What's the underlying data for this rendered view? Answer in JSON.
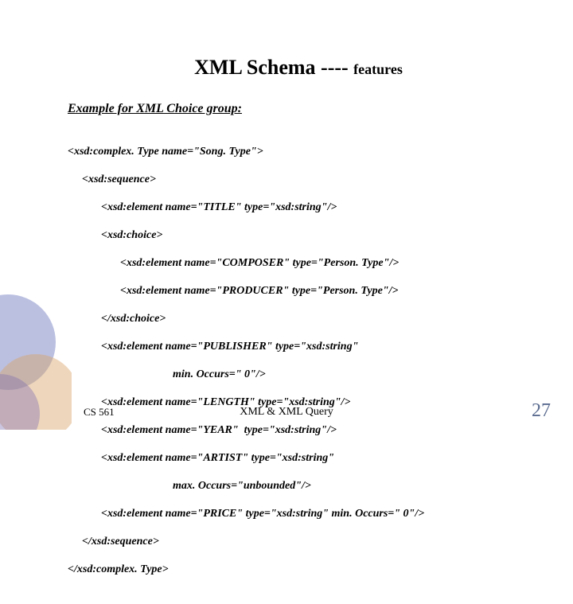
{
  "title_main": "XML Schema ---- ",
  "title_sub": "features",
  "section_heading": "Example for XML Choice group:",
  "code": {
    "l01": "<xsd:complex. Type name=\"Song. Type\">",
    "l02": "<xsd:sequence>",
    "l03": "<xsd:element name=\"TITLE\" type=\"xsd:string\"/>",
    "l04": "<xsd:choice>",
    "l05": "<xsd:element name=\"COMPOSER\" type=\"Person. Type\"/>",
    "l06": "<xsd:element name=\"PRODUCER\" type=\"Person. Type\"/>",
    "l07": "</xsd:choice>",
    "l08": "<xsd:element name=\"PUBLISHER\" type=\"xsd:string\"",
    "l09": "min. Occurs=\" 0\"/>",
    "l10": "<xsd:element name=\"LENGTH\" type=\"xsd:string\"/>",
    "l11": "<xsd:element name=\"YEAR\"  type=\"xsd:string\"/>",
    "l12": "<xsd:element name=\"ARTIST\" type=\"xsd:string\"",
    "l13": "max. Occurs=\"unbounded\"/>",
    "l14": "<xsd:element name=\"PRICE\" type=\"xsd:string\" min. Occurs=\" 0\"/>",
    "l15": "</xsd:sequence>",
    "l16": "</xsd:complex. Type>"
  },
  "footer_left": "CS 561",
  "footer_center": "XML & XML Query",
  "page_number": "27"
}
